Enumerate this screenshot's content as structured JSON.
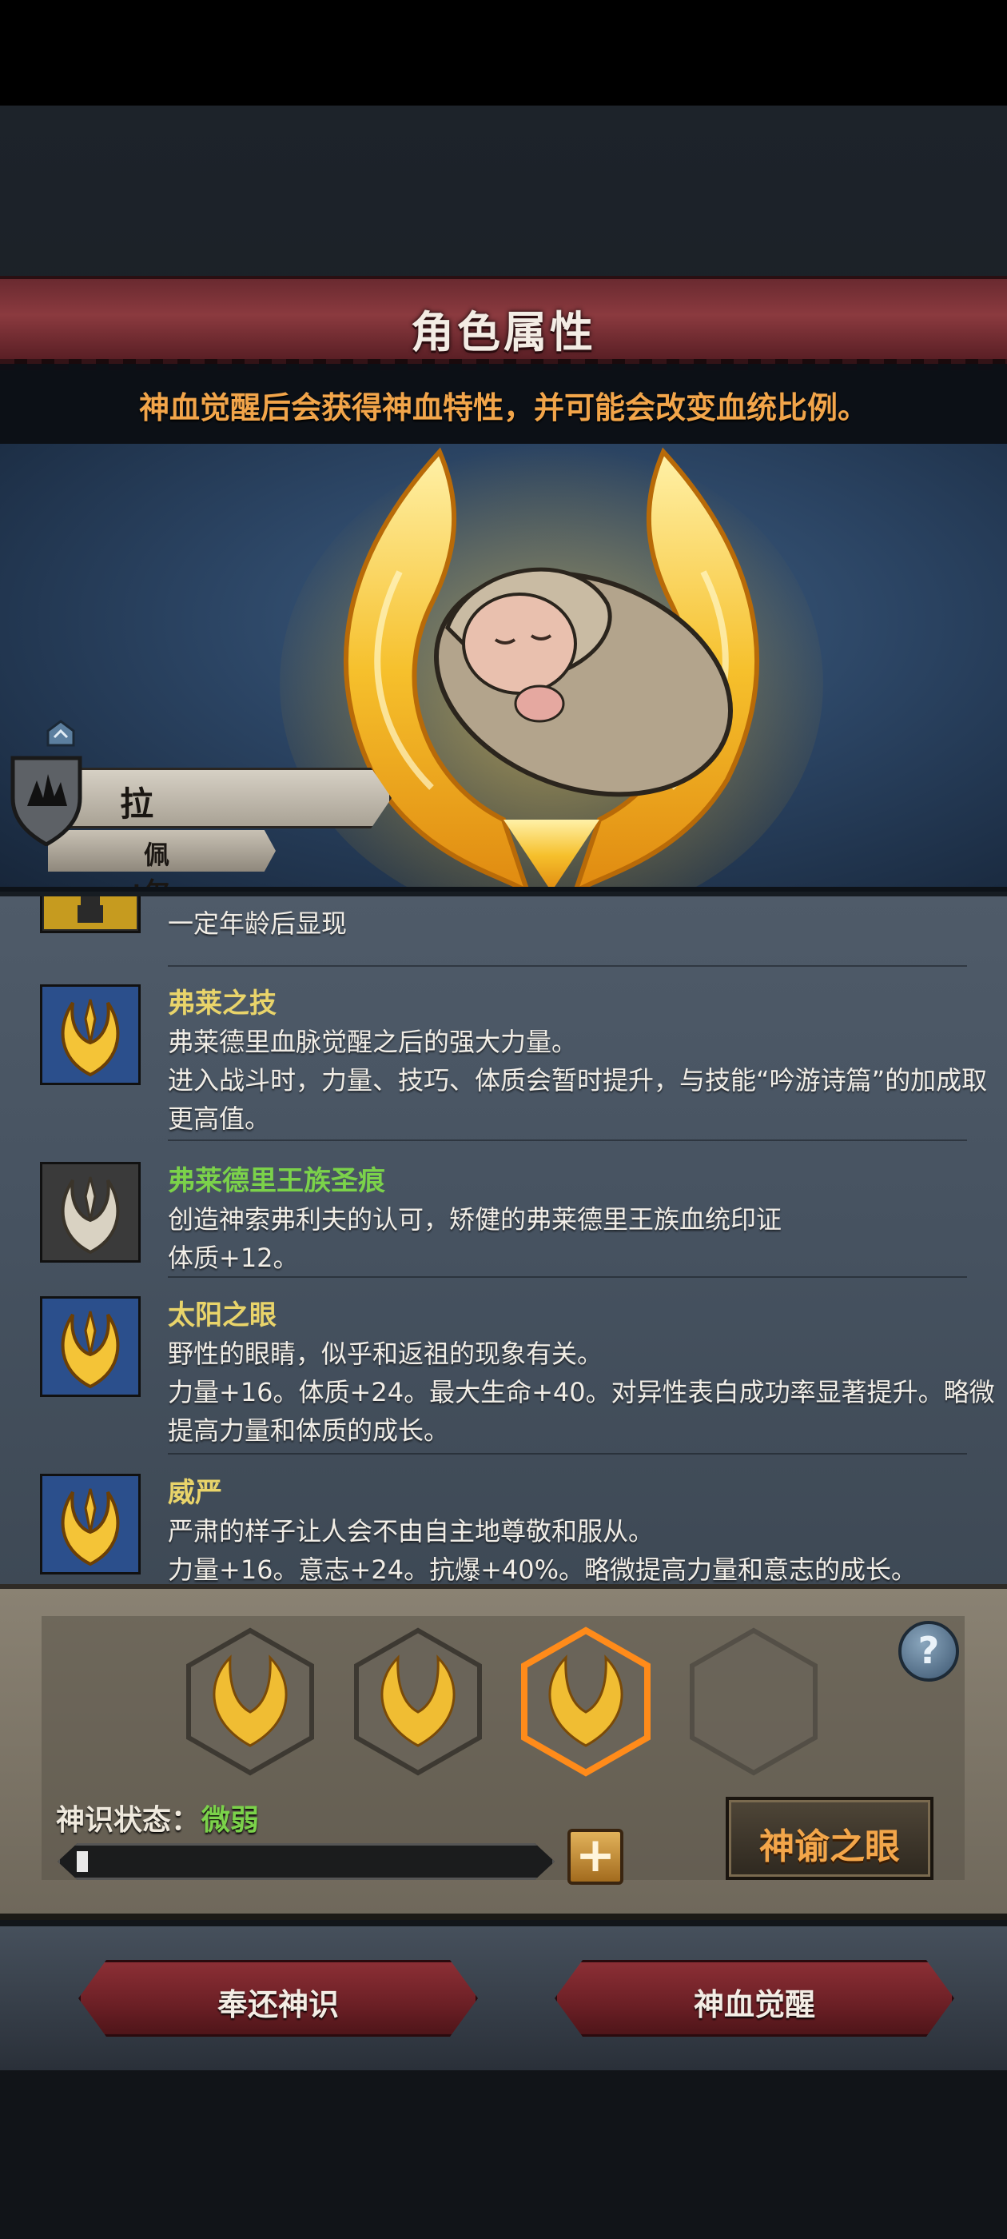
{
  "header": {
    "title": "角色属性",
    "subtitle": "神血觉醒后会获得神血特性，并可能会改变血统比例。"
  },
  "character": {
    "name": "拉尔夫",
    "house": "佩尔"
  },
  "traits": [
    {
      "name": "",
      "desc": "一定年龄后显现",
      "icon": "locked-trait-icon",
      "name_color": "#e9d46a"
    },
    {
      "name": "弗莱之技",
      "desc": "弗莱德里血脉觉醒之后的强大力量。\n进入战斗时，力量、技巧、体质会暂时提升，与技能“吟游诗篇”的加成取更高值。",
      "icon": "golden-flame-icon",
      "name_color": "#e9d46a"
    },
    {
      "name": "弗莱德里王族圣痕",
      "desc": "创造神索弗利夫的认可，矫健的弗莱德里王族血统印证\n体质+12。",
      "icon": "silver-flame-icon",
      "name_color": "#7bd24a"
    },
    {
      "name": "太阳之眼",
      "desc": "野性的眼睛，似乎和返祖的现象有关。\n力量+16。体质+24。最大生命+40。对异性表白成功率显著提升。略微提高力量和体质的成长。",
      "icon": "golden-flame-icon",
      "name_color": "#e9d46a"
    },
    {
      "name": "威严",
      "desc": "严肃的样子让人会不由自主地尊敬和服从。\n力量+16。意志+24。抗爆+40%。略微提高力量和意志的成长。",
      "icon": "golden-flame-icon",
      "name_color": "#e9d46a"
    }
  ],
  "awakening": {
    "slots": [
      "filled",
      "filled",
      "selected",
      "empty"
    ],
    "status_label": "神识状态：",
    "status_value": "微弱",
    "progress": 0.02,
    "oracle_button": "神谕之眼",
    "help": "?",
    "plus": "+"
  },
  "actions": {
    "return_label": "奉还神识",
    "awaken_label": "神血觉醒"
  }
}
